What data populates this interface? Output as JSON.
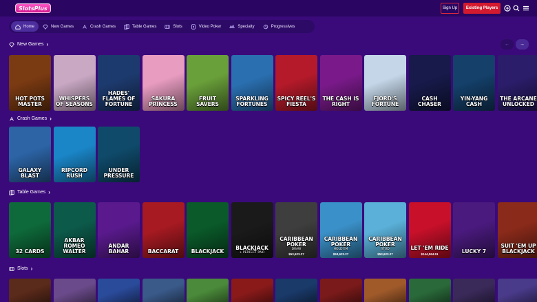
{
  "header": {
    "logo": "SlotsPlus",
    "sign_up": "Sign Up",
    "existing_players": "Existing Players",
    "icons": [
      "chat-icon",
      "search-icon",
      "menu-icon"
    ]
  },
  "nav": {
    "items": [
      {
        "label": "Home",
        "icon": "house-icon",
        "active": true
      },
      {
        "label": "New Games",
        "icon": "diamond-icon"
      },
      {
        "label": "Crash Games",
        "icon": "rocket-icon"
      },
      {
        "label": "Table Games",
        "icon": "cards-icon"
      },
      {
        "label": "Slots",
        "icon": "slot-icon"
      },
      {
        "label": "Video Poker",
        "icon": "poker-icon"
      },
      {
        "label": "Specialty",
        "icon": "specialty-icon"
      },
      {
        "label": "Progressives",
        "icon": "progressive-icon"
      }
    ]
  },
  "sections": {
    "new_games": {
      "title": "New Games",
      "games": [
        {
          "name": "HOT POTS MASTER",
          "color": "#7a3a12"
        },
        {
          "name": "WHISPERS OF SEASONS",
          "color": "#c9a8c4"
        },
        {
          "name": "HADES' FLAMES OF FORTUNE",
          "color": "#1d3a6e"
        },
        {
          "name": "SAKURA PRINCESS",
          "color": "#e89cc0"
        },
        {
          "name": "FRUIT SAVERS",
          "color": "#6aa03a"
        },
        {
          "name": "SPARKLING FORTUNES",
          "color": "#2a6fb0"
        },
        {
          "name": "SPICY REEL'S FIESTA",
          "color": "#b51a2a"
        },
        {
          "name": "THE CASH IS RIGHT",
          "color": "#7a1a8a"
        },
        {
          "name": "FJORD'S FORTUNE",
          "color": "#c4d6e8"
        },
        {
          "name": "CASH CHASER",
          "color": "#171a4a"
        },
        {
          "name": "YIN-YANG CASH",
          "color": "#14406a"
        },
        {
          "name": "THE ARCANE UNLOCKED",
          "color": "#2b1d6a"
        }
      ]
    },
    "crash_games": {
      "title": "Crash Games",
      "games": [
        {
          "name": "GALAXY BLAST",
          "color": "#2c64a6"
        },
        {
          "name": "RIPCORD RUSH",
          "color": "#1a86c8"
        },
        {
          "name": "UNDER PRESSURE",
          "color": "#0f4a6a"
        }
      ]
    },
    "table_games": {
      "title": "Table Games",
      "games": [
        {
          "name": "32 CARDS",
          "color": "#0e6a3a",
          "jackpot": ""
        },
        {
          "name": "AKBAR ROMEO WALTER",
          "color": "#0c5a4a",
          "jackpot": ""
        },
        {
          "name": "ANDAR BAHAR",
          "color": "#5a1a8e",
          "jackpot": ""
        },
        {
          "name": "BACCARAT",
          "color": "#a81a22",
          "jackpot": ""
        },
        {
          "name": "BLACKJACK",
          "color": "#0a5a2a",
          "jackpot": ""
        },
        {
          "name": "BLACKJACK",
          "sub": "+ PERFECT PAIR",
          "color": "#1a1a1a",
          "jackpot": ""
        },
        {
          "name": "CARIBBEAN POKER",
          "sub": "DRAW",
          "color": "#3e3e3e",
          "jackpot": "$53,623.27"
        },
        {
          "name": "CARIBBEAN POKER",
          "sub": "HOLD'EM",
          "color": "#3a90c8",
          "jackpot": "$53,623.27"
        },
        {
          "name": "CARIBBEAN POKER",
          "sub": "STUD",
          "color": "#5ab0d8",
          "jackpot": "$53,623.27"
        },
        {
          "name": "LET 'EM RIDE",
          "color": "#c8102a",
          "jackpot": "$144,064.51"
        },
        {
          "name": "LUCKY 7",
          "color": "#4a1a7e",
          "jackpot": ""
        },
        {
          "name": "SUIT 'EM UP BLACKJACK",
          "color": "#8a2a1a",
          "jackpot": ""
        }
      ]
    },
    "slots": {
      "title": "Slots",
      "games": [
        {
          "name": "",
          "color": "#5a2a1a"
        },
        {
          "name": "",
          "color": "#6a4a8a"
        },
        {
          "name": "",
          "color": "#2a4a9a"
        },
        {
          "name": "",
          "color": "#3a5a8a"
        },
        {
          "name": "",
          "color": "#4a8a3a"
        },
        {
          "name": "",
          "color": "#8a1a1a"
        },
        {
          "name": "",
          "color": "#1a3a6a"
        },
        {
          "name": "",
          "color": "#7a1a1a"
        },
        {
          "name": "",
          "color": "#a05a2a"
        },
        {
          "name": "",
          "color": "#2a6a3a"
        },
        {
          "name": "",
          "color": "#3a2a5a"
        },
        {
          "name": "",
          "color": "#4a3a8a"
        }
      ]
    }
  }
}
